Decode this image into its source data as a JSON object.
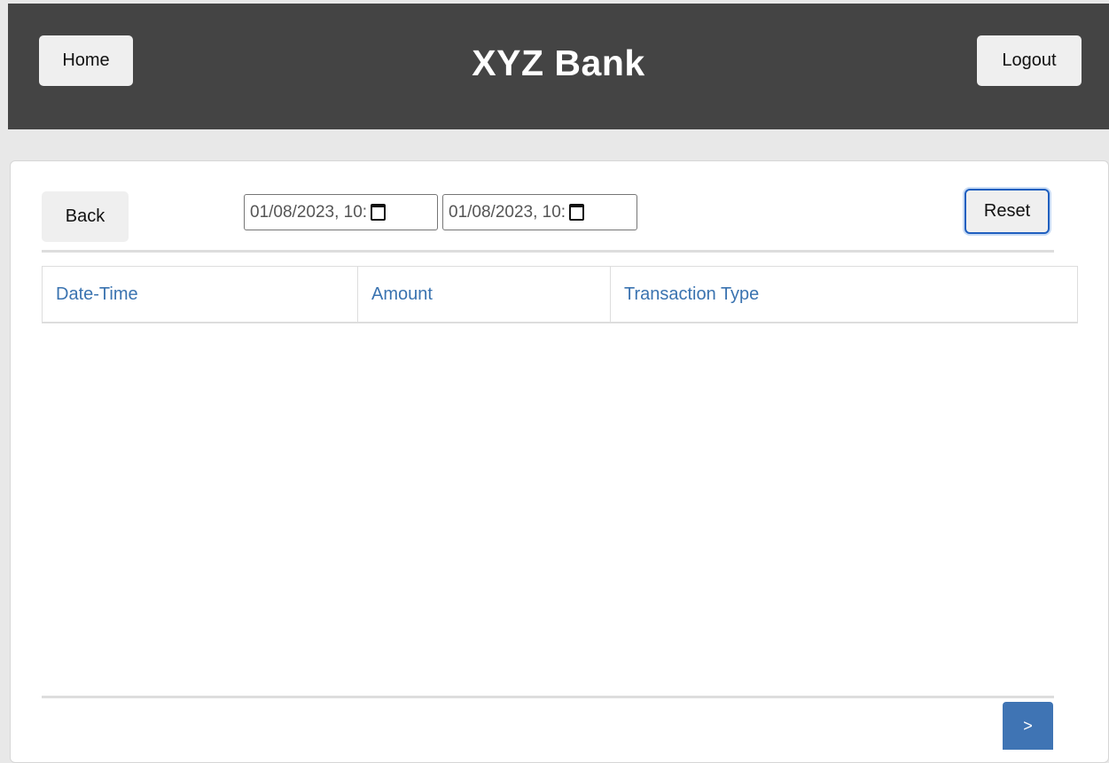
{
  "header": {
    "title": "XYZ Bank",
    "home_label": "Home",
    "logout_label": "Logout"
  },
  "toolbar": {
    "back_label": "Back",
    "from_datetime": "01/08/2023, 10:",
    "to_datetime": "01/08/2023, 10:",
    "reset_label": "Reset"
  },
  "table": {
    "columns": [
      "Date-Time",
      "Amount",
      "Transaction Type"
    ],
    "rows": []
  },
  "pagination": {
    "next_label": ">"
  },
  "colors": {
    "header_bg": "#444444",
    "link_blue": "#3a73b0",
    "primary_button": "#3f74b4",
    "focus_ring": "#1f5fbf"
  },
  "icons": {
    "datetime_picker": "calendar-icon"
  }
}
